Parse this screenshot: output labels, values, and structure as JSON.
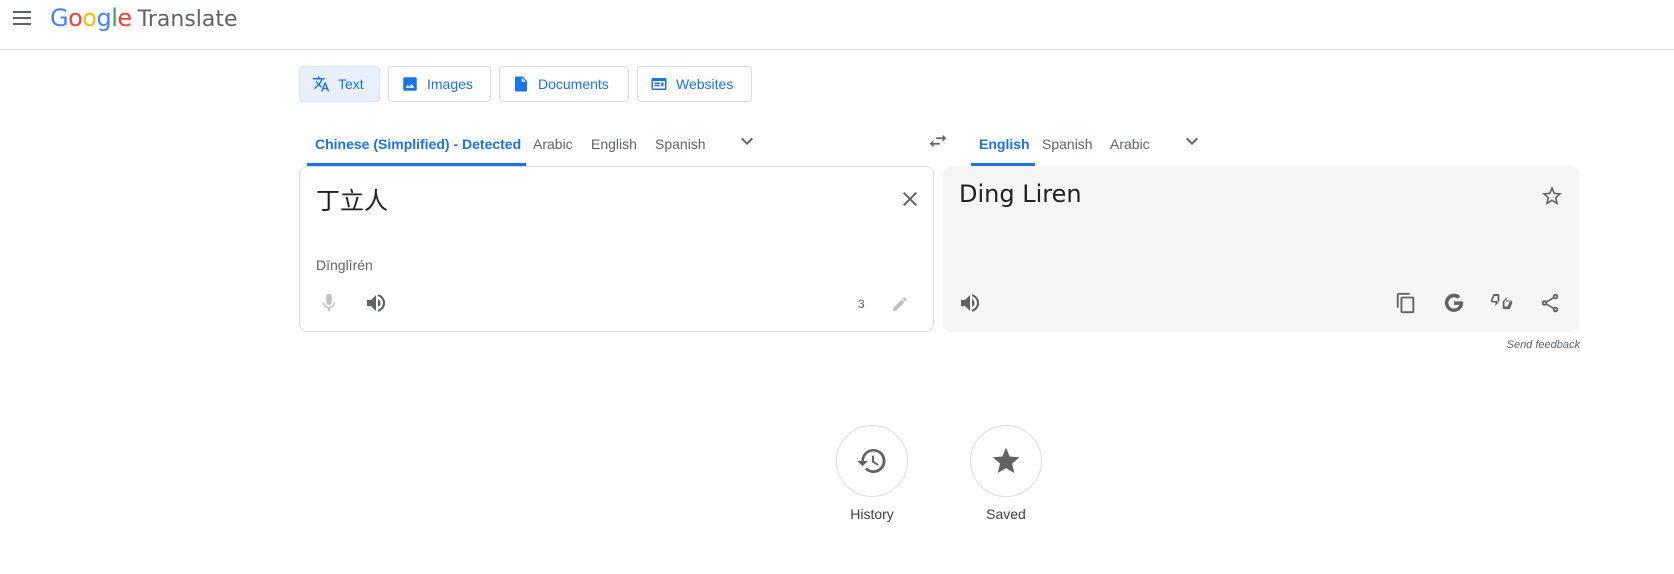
{
  "header": {
    "logo_google": "Google",
    "logo_translate": "Translate"
  },
  "modes": [
    {
      "label": "Text",
      "active": true
    },
    {
      "label": "Images"
    },
    {
      "label": "Documents"
    },
    {
      "label": "Websites"
    }
  ],
  "source_languages": [
    "Chinese (Simplified) - Detected",
    "Arabic",
    "English",
    "Spanish"
  ],
  "target_languages": [
    "English",
    "Spanish",
    "Arabic"
  ],
  "source": {
    "text": "丁立人",
    "romanization": "Dīnglìrén",
    "char_count": "3"
  },
  "target": {
    "text": "Ding Liren"
  },
  "feedback_label": "Send feedback",
  "footer": {
    "history_label": "History",
    "saved_label": "Saved"
  },
  "colors": {
    "accent": "#1a73e8",
    "google_blue": "#4285f4",
    "google_red": "#ea4335",
    "google_yellow": "#fbbc05",
    "google_green": "#34a853"
  }
}
